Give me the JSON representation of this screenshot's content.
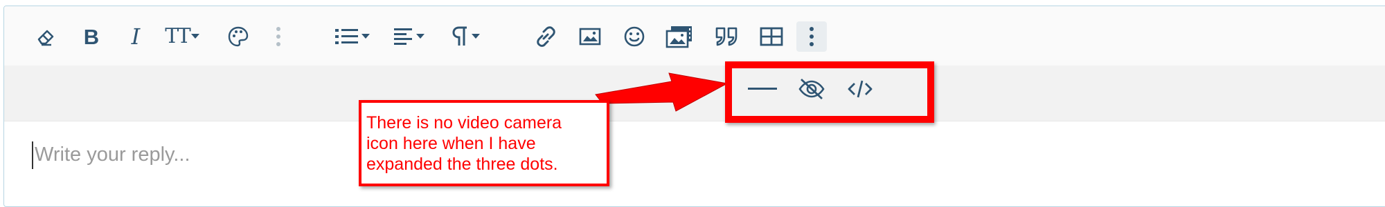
{
  "toolbar": {
    "row1": [
      {
        "name": "remove-formatting-icon",
        "kind": "icon"
      },
      {
        "name": "bold-button",
        "kind": "text",
        "label": "B"
      },
      {
        "name": "italic-button",
        "kind": "text",
        "label": "I"
      },
      {
        "name": "font-size-button",
        "kind": "text",
        "label": "TT"
      },
      {
        "name": "palette-icon",
        "kind": "icon"
      },
      {
        "name": "more-vertical-icon",
        "kind": "icon"
      },
      {
        "name": "list-icon",
        "kind": "icon"
      },
      {
        "name": "align-icon",
        "kind": "icon"
      },
      {
        "name": "paragraph-icon",
        "kind": "icon"
      },
      {
        "name": "link-icon",
        "kind": "icon"
      },
      {
        "name": "image-icon",
        "kind": "icon"
      },
      {
        "name": "smiley-icon",
        "kind": "icon"
      },
      {
        "name": "media-gallery-icon",
        "kind": "icon"
      },
      {
        "name": "quote-icon",
        "kind": "icon"
      },
      {
        "name": "table-icon",
        "kind": "icon"
      },
      {
        "name": "more-vertical-active-icon",
        "kind": "icon"
      }
    ],
    "row2": [
      {
        "name": "horizontal-line-icon",
        "kind": "icon"
      },
      {
        "name": "spoiler-eye-slash-icon",
        "kind": "icon"
      },
      {
        "name": "code-icon",
        "kind": "icon"
      }
    ],
    "bold_label": "B",
    "italic_label": "I",
    "font_size_label": "TT"
  },
  "editor": {
    "placeholder": "Write your reply..."
  },
  "annotation": {
    "lines": [
      "There is no video camera",
      "icon here when I have",
      "expanded the three dots."
    ]
  },
  "colors": {
    "icon": "#2f5573",
    "annotation": "#ff0000",
    "toolbar_row1_bg": "#fafafa",
    "toolbar_row2_bg": "#f2f2f2",
    "border": "#b6d5e3",
    "placeholder": "#9a9a9a"
  }
}
